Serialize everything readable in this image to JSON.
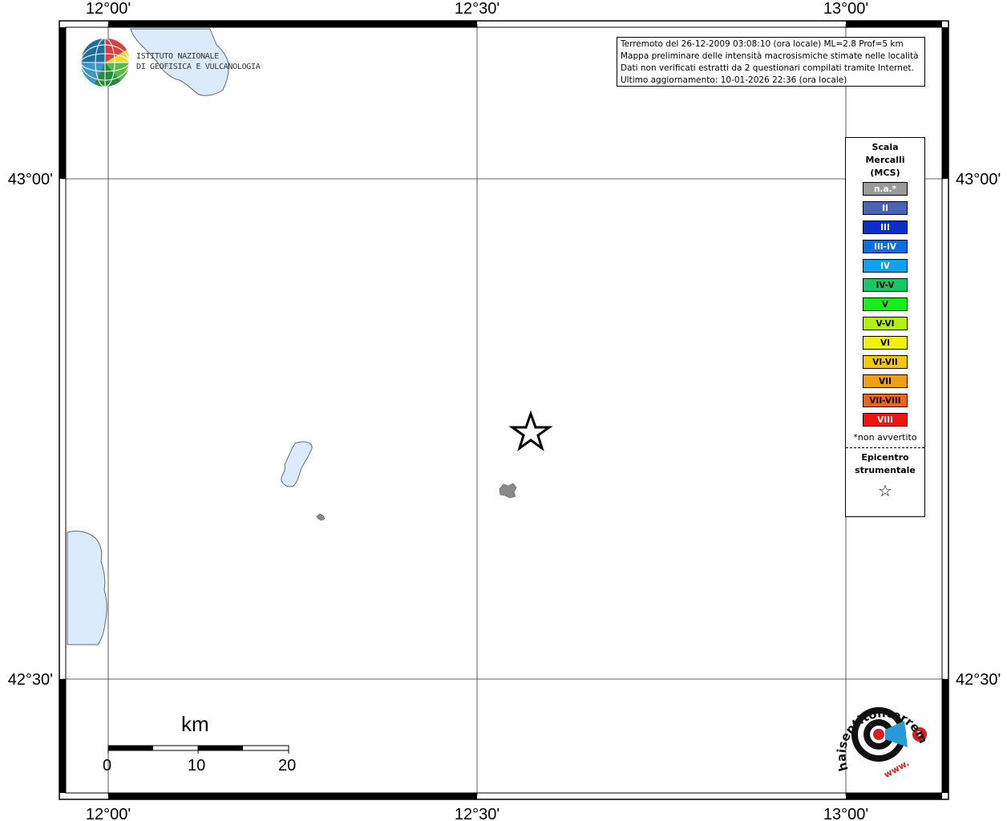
{
  "axis_labels": {
    "top": [
      "12°00'",
      "12°30'",
      "13°00'"
    ],
    "bottom": [
      "12°00'",
      "12°30'",
      "13°00'"
    ],
    "left": [
      "43°00'",
      "42°30'"
    ],
    "right": [
      "43°00'",
      "42°30'"
    ]
  },
  "logo": {
    "line1": "ISTITUTO NAZIONALE",
    "line2": "DI GEOFISICA E VULCANOLOGIA"
  },
  "info": {
    "line1": "Terremoto del 26-12-2009 03:08:10 (ora locale) ML=2.8 Prof=5 km",
    "line2": "Mappa preliminare delle intensità macrosismiche stimate nelle località",
    "line3": "Dati non verificati estratti da 2 questionari compilati tramite Internet.",
    "line4": "Ultimo aggiornamento: 10-01-2026 22:36 (ora locale)"
  },
  "legend": {
    "title_line1": "Scala",
    "title_line2": "Mercalli",
    "title_line3": "(MCS)",
    "items": [
      {
        "label": "n.a.*",
        "color": "#9a9a9a",
        "text_color": "#ffffff"
      },
      {
        "label": "II",
        "color": "#4a63b8",
        "text_color": "#ffffff"
      },
      {
        "label": "III",
        "color": "#0a2ec8",
        "text_color": "#ffffff"
      },
      {
        "label": "III-IV",
        "color": "#0a6ee0",
        "text_color": "#ffffff"
      },
      {
        "label": "IV",
        "color": "#14a0f0",
        "text_color": "#ffffff"
      },
      {
        "label": "IV-V",
        "color": "#14c864",
        "text_color": "#000000"
      },
      {
        "label": "V",
        "color": "#14f014",
        "text_color": "#000000"
      },
      {
        "label": "V-VI",
        "color": "#b4f014",
        "text_color": "#000000"
      },
      {
        "label": "VI",
        "color": "#f0f014",
        "text_color": "#000000"
      },
      {
        "label": "VI-VII",
        "color": "#f0c814",
        "text_color": "#000000"
      },
      {
        "label": "VII",
        "color": "#f0a014",
        "text_color": "#000000"
      },
      {
        "label": "VII-VIII",
        "color": "#f06414",
        "text_color": "#000000"
      },
      {
        "label": "VIII",
        "color": "#f01414",
        "text_color": "#ffffff"
      }
    ],
    "note": "*non avvertito",
    "epicenter_line1": "Epicentro",
    "epicenter_line2": "strumentale",
    "epicenter_symbol": "☆"
  },
  "scale_bar": {
    "unit": "km",
    "ticks": [
      "0",
      "10",
      "20"
    ]
  },
  "bottom_logo": {
    "text": "haisentitoilterremoto.it",
    "url": "www."
  },
  "colors": {
    "water": "#dcebfa",
    "coast": "#5a6a7a",
    "town": "#8a8a8a"
  }
}
